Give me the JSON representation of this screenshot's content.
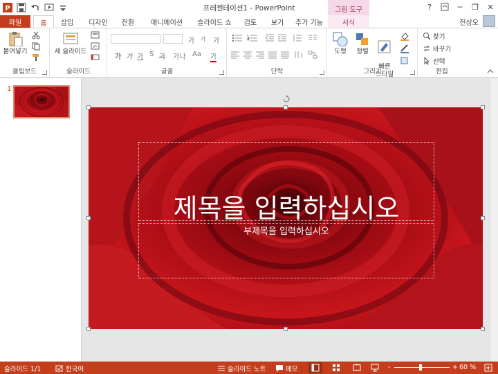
{
  "window": {
    "title": "프레젠테이션1 - PowerPoint",
    "context_group": "그림 도구",
    "user": "전상오",
    "help": "?",
    "minimize": "─",
    "restore": "❐",
    "close": "✕"
  },
  "tabs": [
    {
      "label": "파일"
    },
    {
      "label": "홈"
    },
    {
      "label": "삽입"
    },
    {
      "label": "디자인"
    },
    {
      "label": "전환"
    },
    {
      "label": "애니메이션"
    },
    {
      "label": "슬라이드 쇼"
    },
    {
      "label": "검토"
    },
    {
      "label": "보기"
    },
    {
      "label": "추가 기능"
    },
    {
      "label": "서식"
    }
  ],
  "ribbon": {
    "clipboard": {
      "label": "클립보드",
      "paste": "붙여넣기"
    },
    "slides": {
      "label": "슬라이드",
      "new_slide": "새 슬라이드"
    },
    "font": {
      "label": "글꼴",
      "grow": "가",
      "shrink": "가",
      "clear": "가",
      "bold": "가",
      "italic": "가",
      "underline": "가",
      "strike": "가",
      "shadow": "S",
      "spacing": "가나",
      "case": "Aa",
      "color": "가"
    },
    "paragraph": {
      "label": "단락"
    },
    "drawing": {
      "label": "그리기",
      "shapes": "도형",
      "arrange": "정렬",
      "quick_styles": "빠른\n스타일"
    },
    "editing": {
      "label": "편집",
      "find": "찾기",
      "replace": "바꾸기",
      "select": "선택"
    }
  },
  "thumbnails": [
    {
      "number": "1"
    }
  ],
  "slide": {
    "title_placeholder": "제목을 입력하십시오",
    "subtitle_placeholder": "부제목을 입력하십시오"
  },
  "status": {
    "slide_count": "슬라이드 1/1",
    "language": "한국어",
    "notes": "슬라이드 노트",
    "comments": "메모",
    "zoom": "60 %",
    "zoom_minus": "-",
    "zoom_plus": "+"
  },
  "colors": {
    "accent": "#c43e1c",
    "context": "#a4375d"
  }
}
